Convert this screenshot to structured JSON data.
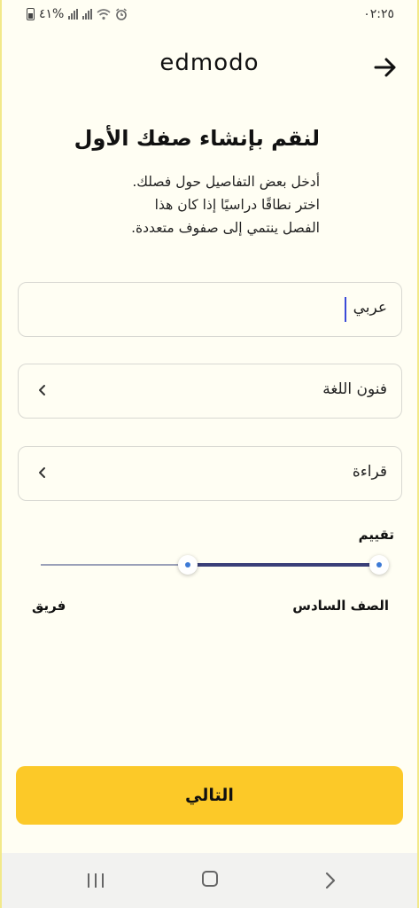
{
  "status_bar": {
    "battery_text": "٤١%",
    "time": "٠٢:٢٥"
  },
  "header": {
    "logo": "edmodo",
    "back_icon": "arrow-right-icon"
  },
  "intro": {
    "title": "لنقم بإنشاء صفك الأول",
    "description_lines": [
      "أدخل بعض التفاصيل حول فصلك.",
      "اختر نطاقًا دراسيًا إذا كان هذا",
      "الفصل ينتمي إلى صفوف متعددة."
    ]
  },
  "form": {
    "class_name_value": "عربي",
    "subject_value": "فنون اللغة",
    "topic_value": "قراءة",
    "chevron_icon": "chevron-left-icon"
  },
  "grade_range": {
    "label": "تقييم",
    "min_label": "الصف السادس",
    "max_label": "فريق"
  },
  "actions": {
    "next_label": "التالي"
  },
  "colors": {
    "background": "#fffef3",
    "accent": "#fcc928",
    "slider_active": "#3a3f78",
    "knob_dot": "#3d7ad6"
  }
}
